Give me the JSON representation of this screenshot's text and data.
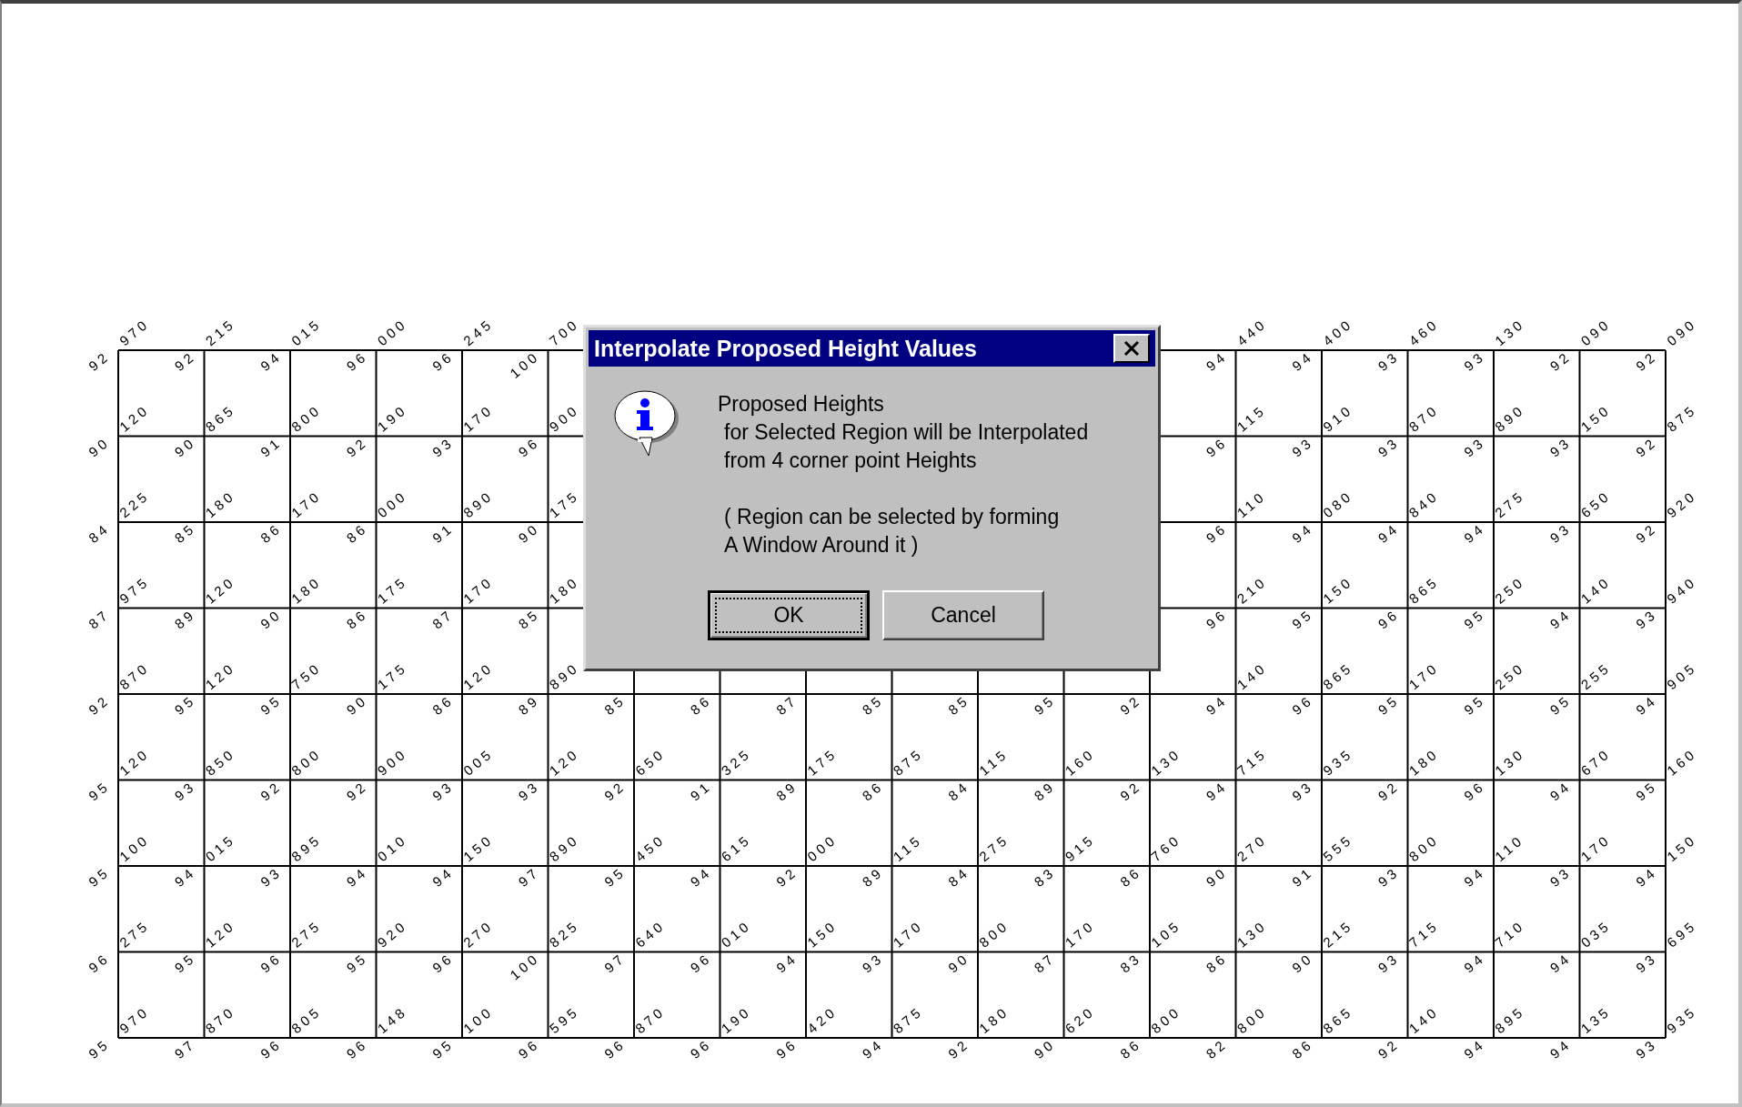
{
  "canvas": {
    "grid": {
      "rows": [
        [
          {
            "whole": "92",
            "fraction": "970"
          },
          {
            "whole": "92",
            "fraction": "215"
          },
          {
            "whole": "94",
            "fraction": "015"
          },
          {
            "whole": "96",
            "fraction": "000"
          },
          {
            "whole": "96",
            "fraction": "245"
          },
          {
            "whole": "100",
            "fraction": "700"
          },
          null,
          null,
          null,
          null,
          null,
          null,
          null,
          {
            "whole": "94",
            "fraction": "440"
          },
          {
            "whole": "94",
            "fraction": "400"
          },
          {
            "whole": "93",
            "fraction": "460"
          },
          {
            "whole": "93",
            "fraction": "130"
          },
          {
            "whole": "92",
            "fraction": "090"
          },
          {
            "whole": "92",
            "fraction": "090"
          }
        ],
        [
          {
            "whole": "90",
            "fraction": "120"
          },
          {
            "whole": "90",
            "fraction": "865"
          },
          {
            "whole": "91",
            "fraction": "800"
          },
          {
            "whole": "92",
            "fraction": "190"
          },
          {
            "whole": "93",
            "fraction": "170"
          },
          {
            "whole": "96",
            "fraction": "900"
          },
          null,
          null,
          null,
          null,
          null,
          null,
          null,
          {
            "whole": "96",
            "fraction": "115"
          },
          {
            "whole": "93",
            "fraction": "910"
          },
          {
            "whole": "93",
            "fraction": "870"
          },
          {
            "whole": "93",
            "fraction": "890"
          },
          {
            "whole": "93",
            "fraction": "150"
          },
          {
            "whole": "92",
            "fraction": "875"
          }
        ],
        [
          {
            "whole": "84",
            "fraction": "225"
          },
          {
            "whole": "85",
            "fraction": "180"
          },
          {
            "whole": "86",
            "fraction": "170"
          },
          {
            "whole": "86",
            "fraction": "000"
          },
          {
            "whole": "91",
            "fraction": "890"
          },
          {
            "whole": "90",
            "fraction": "175"
          },
          null,
          null,
          null,
          null,
          null,
          null,
          null,
          {
            "whole": "96",
            "fraction": "110"
          },
          {
            "whole": "94",
            "fraction": "080"
          },
          {
            "whole": "94",
            "fraction": "840"
          },
          {
            "whole": "94",
            "fraction": "275"
          },
          {
            "whole": "93",
            "fraction": "650"
          },
          {
            "whole": "92",
            "fraction": "920"
          }
        ],
        [
          {
            "whole": "87",
            "fraction": "975"
          },
          {
            "whole": "89",
            "fraction": "120"
          },
          {
            "whole": "90",
            "fraction": "180"
          },
          {
            "whole": "86",
            "fraction": "175"
          },
          {
            "whole": "87",
            "fraction": "170"
          },
          {
            "whole": "85",
            "fraction": "180"
          },
          null,
          null,
          null,
          null,
          null,
          null,
          null,
          {
            "whole": "96",
            "fraction": "210"
          },
          {
            "whole": "95",
            "fraction": "150"
          },
          {
            "whole": "96",
            "fraction": "865"
          },
          {
            "whole": "95",
            "fraction": "250"
          },
          {
            "whole": "94",
            "fraction": "140"
          },
          {
            "whole": "93",
            "fraction": "940"
          }
        ],
        [
          {
            "whole": "92",
            "fraction": "870"
          },
          {
            "whole": "95",
            "fraction": "120"
          },
          {
            "whole": "95",
            "fraction": "750"
          },
          {
            "whole": "90",
            "fraction": "175"
          },
          {
            "whole": "86",
            "fraction": "120"
          },
          {
            "whole": "89",
            "fraction": "890"
          },
          {
            "whole": "85"
          },
          {
            "whole": "86"
          },
          {
            "whole": "87"
          },
          {
            "whole": "85"
          },
          {
            "whole": "85"
          },
          {
            "whole": "95"
          },
          {
            "whole": "92"
          },
          {
            "whole": "94",
            "fraction": "140"
          },
          {
            "whole": "96",
            "fraction": "865"
          },
          {
            "whole": "95",
            "fraction": "170"
          },
          {
            "whole": "95",
            "fraction": "250"
          },
          {
            "whole": "95",
            "fraction": "255"
          },
          {
            "whole": "94",
            "fraction": "905"
          }
        ],
        [
          {
            "whole": "95",
            "fraction": "120"
          },
          {
            "whole": "93",
            "fraction": "850"
          },
          {
            "whole": "92",
            "fraction": "800"
          },
          {
            "whole": "92",
            "fraction": "900"
          },
          {
            "whole": "93",
            "fraction": "005"
          },
          {
            "whole": "93",
            "fraction": "120"
          },
          {
            "whole": "92",
            "fraction": "650"
          },
          {
            "whole": "91",
            "fraction": "325"
          },
          {
            "whole": "89",
            "fraction": "175"
          },
          {
            "whole": "86",
            "fraction": "875"
          },
          {
            "whole": "84",
            "fraction": "115"
          },
          {
            "whole": "89",
            "fraction": "160"
          },
          {
            "whole": "92",
            "fraction": "130"
          },
          {
            "whole": "94",
            "fraction": "715"
          },
          {
            "whole": "93",
            "fraction": "935"
          },
          {
            "whole": "92",
            "fraction": "180"
          },
          {
            "whole": "96",
            "fraction": "130"
          },
          {
            "whole": "94",
            "fraction": "670"
          },
          {
            "whole": "95",
            "fraction": "160"
          }
        ],
        [
          {
            "whole": "95",
            "fraction": "100"
          },
          {
            "whole": "94",
            "fraction": "015"
          },
          {
            "whole": "93",
            "fraction": "895"
          },
          {
            "whole": "94",
            "fraction": "010"
          },
          {
            "whole": "94",
            "fraction": "150"
          },
          {
            "whole": "97",
            "fraction": "890"
          },
          {
            "whole": "95",
            "fraction": "450"
          },
          {
            "whole": "94",
            "fraction": "615"
          },
          {
            "whole": "92",
            "fraction": "000"
          },
          {
            "whole": "89",
            "fraction": "115"
          },
          {
            "whole": "84",
            "fraction": "275"
          },
          {
            "whole": "83",
            "fraction": "915"
          },
          {
            "whole": "86",
            "fraction": "760"
          },
          {
            "whole": "90",
            "fraction": "270"
          },
          {
            "whole": "91",
            "fraction": "555"
          },
          {
            "whole": "93",
            "fraction": "800"
          },
          {
            "whole": "94",
            "fraction": "110"
          },
          {
            "whole": "93",
            "fraction": "170"
          },
          {
            "whole": "94",
            "fraction": "150"
          }
        ],
        [
          {
            "whole": "96",
            "fraction": "275"
          },
          {
            "whole": "95",
            "fraction": "120"
          },
          {
            "whole": "96",
            "fraction": "275"
          },
          {
            "whole": "95",
            "fraction": "920"
          },
          {
            "whole": "96",
            "fraction": "270"
          },
          {
            "whole": "100",
            "fraction": "825"
          },
          {
            "whole": "97",
            "fraction": "640"
          },
          {
            "whole": "96",
            "fraction": "010"
          },
          {
            "whole": "94",
            "fraction": "150"
          },
          {
            "whole": "93",
            "fraction": "170"
          },
          {
            "whole": "90",
            "fraction": "800"
          },
          {
            "whole": "87",
            "fraction": "170"
          },
          {
            "whole": "83",
            "fraction": "105"
          },
          {
            "whole": "86",
            "fraction": "130"
          },
          {
            "whole": "90",
            "fraction": "215"
          },
          {
            "whole": "93",
            "fraction": "715"
          },
          {
            "whole": "94",
            "fraction": "710"
          },
          {
            "whole": "94",
            "fraction": "035"
          },
          {
            "whole": "93",
            "fraction": "695"
          }
        ],
        [
          {
            "whole": "95",
            "fraction": "970"
          },
          {
            "whole": "97",
            "fraction": "870"
          },
          {
            "whole": "96",
            "fraction": "805"
          },
          {
            "whole": "96",
            "fraction": "148"
          },
          {
            "whole": "95",
            "fraction": "100"
          },
          {
            "whole": "96",
            "fraction": "595"
          },
          {
            "whole": "96",
            "fraction": "870"
          },
          {
            "whole": "96",
            "fraction": "190"
          },
          {
            "whole": "96",
            "fraction": "420"
          },
          {
            "whole": "94",
            "fraction": "875"
          },
          {
            "whole": "92",
            "fraction": "180"
          },
          {
            "whole": "90",
            "fraction": "620"
          },
          {
            "whole": "86",
            "fraction": "800"
          },
          {
            "whole": "82",
            "fraction": "800"
          },
          {
            "whole": "86",
            "fraction": "865"
          },
          {
            "whole": "92",
            "fraction": "140"
          },
          {
            "whole": "94",
            "fraction": "895"
          },
          {
            "whole": "94",
            "fraction": "135"
          },
          {
            "whole": "93",
            "fraction": "935"
          }
        ]
      ]
    }
  },
  "dialog": {
    "title": "Interpolate Proposed Height Values",
    "paragraphs": [
      [
        "Proposed Heights",
        "for Selected Region will be Interpolated",
        "from 4 corner point Heights"
      ],
      [
        "( Region can be selected by forming",
        "A Window Around it )"
      ]
    ],
    "buttons": [
      {
        "label": "OK",
        "default": true
      },
      {
        "label": "Cancel",
        "default": false
      }
    ]
  }
}
